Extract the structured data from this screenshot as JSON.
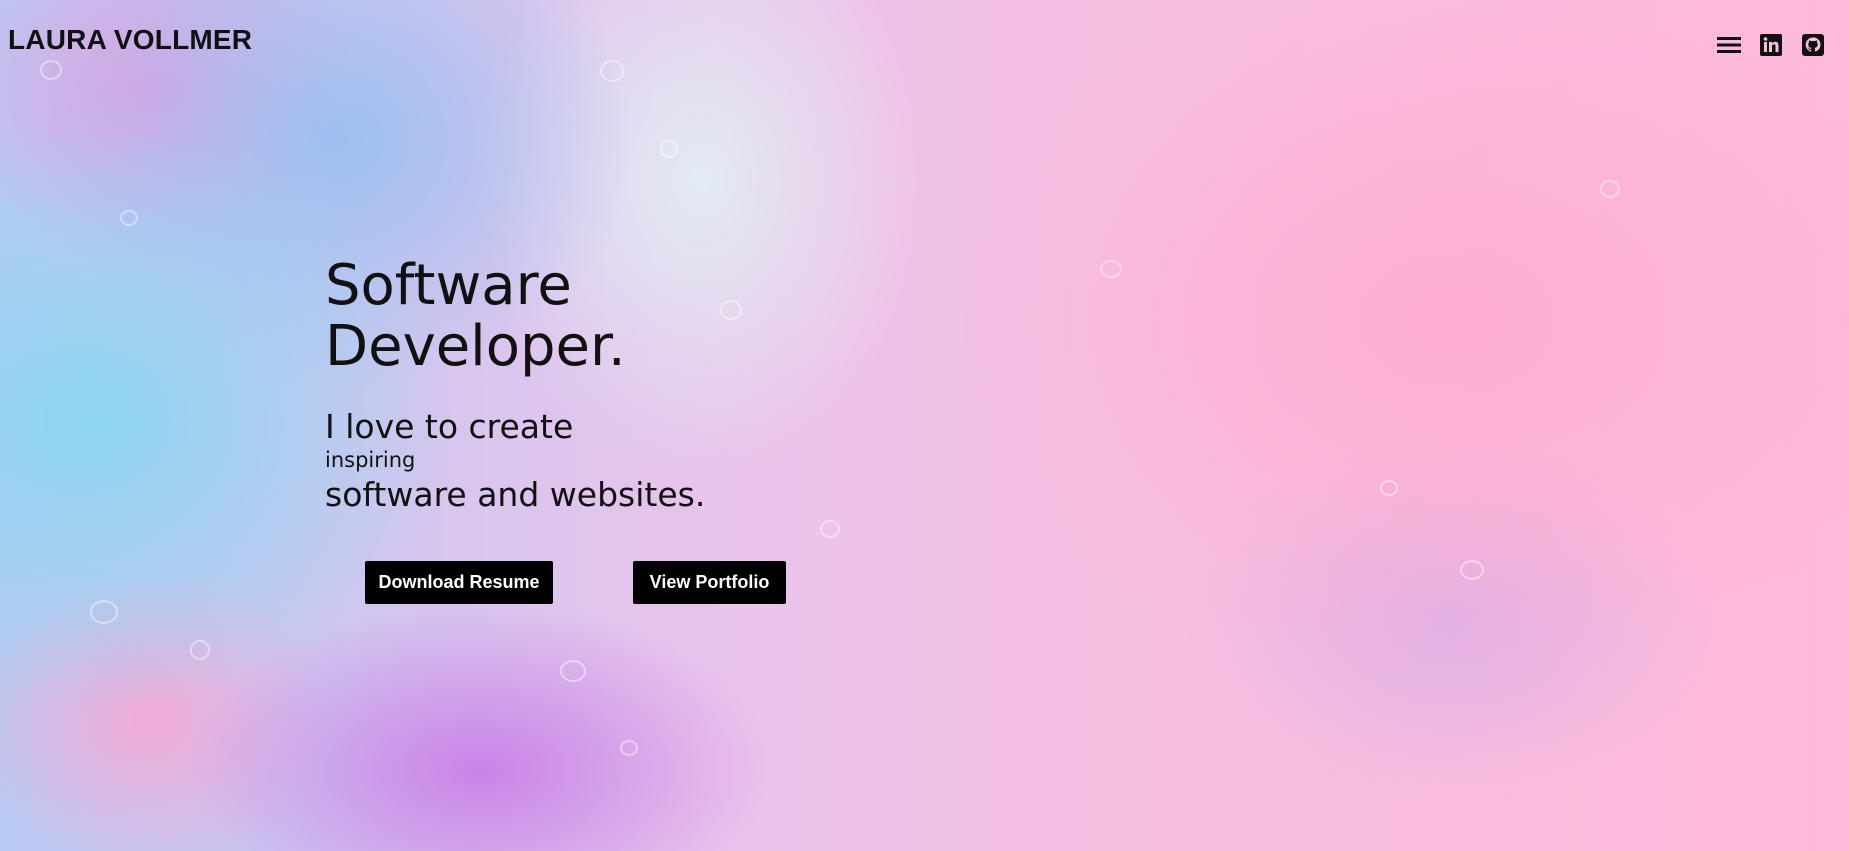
{
  "header": {
    "brand": "LAURA VOLLMER",
    "icons": [
      "menu-icon",
      "linkedin-icon",
      "github-icon"
    ]
  },
  "hero": {
    "title_line1": "Software",
    "title_line2": "Developer.",
    "tagline_line1": "I love to create",
    "tagline_line2": "inspiring",
    "tagline_line3": "software and websites."
  },
  "actions": {
    "download_resume": "Download Resume",
    "view_portfolio": "View Portfolio"
  },
  "colors": {
    "text": "#111111",
    "button_bg": "#000000",
    "button_text": "#ffffff",
    "background_pink": "#ffb9d9",
    "background_blue": "#8ad6f0"
  }
}
